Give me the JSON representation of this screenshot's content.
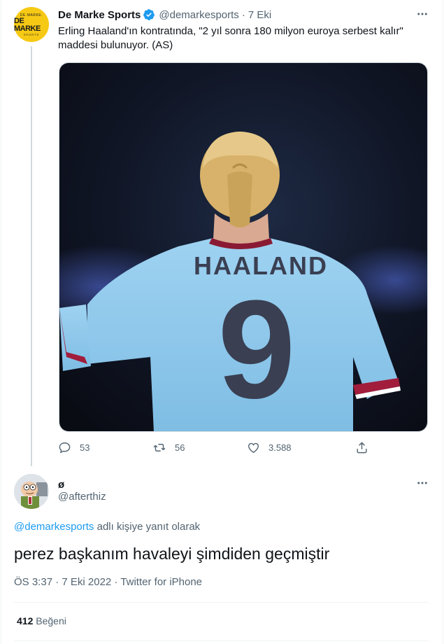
{
  "tweet": {
    "author_name": "De Marke Sports",
    "handle": "@demarkesports",
    "separator": "·",
    "date": "7 Eki",
    "text": "Erling Haaland'ın kontratında, \"2 yıl sonra 180 milyon euroya serbest kalır\" maddesi bulunuyor. (AS)",
    "avatar": {
      "top": "DE·MARKE·",
      "mid": "DE MARKE",
      "bottom": "SPORTS"
    },
    "image": {
      "jersey_name": "HAALAND",
      "jersey_number": "9"
    },
    "actions": {
      "replies": "53",
      "retweets": "56",
      "likes": "3.588"
    }
  },
  "reply": {
    "author_name": "ø",
    "handle": "@afterthiz",
    "replying_to_handle": "@demarkesports",
    "replying_suffix": " adlı kişiye yanıt olarak",
    "text": "perez başkanım havaleyi şimdiden geçmiştir",
    "meta": "ÖS 3:37 · 7 Eki 2022 · Twitter for iPhone",
    "like_count": "412",
    "like_label": " Beğeni"
  },
  "colors": {
    "accent": "#1d9bf0",
    "muted": "#536471",
    "text": "#0f1419",
    "avatar_bg": "#f6c915",
    "jersey": "#8ec7ea"
  }
}
